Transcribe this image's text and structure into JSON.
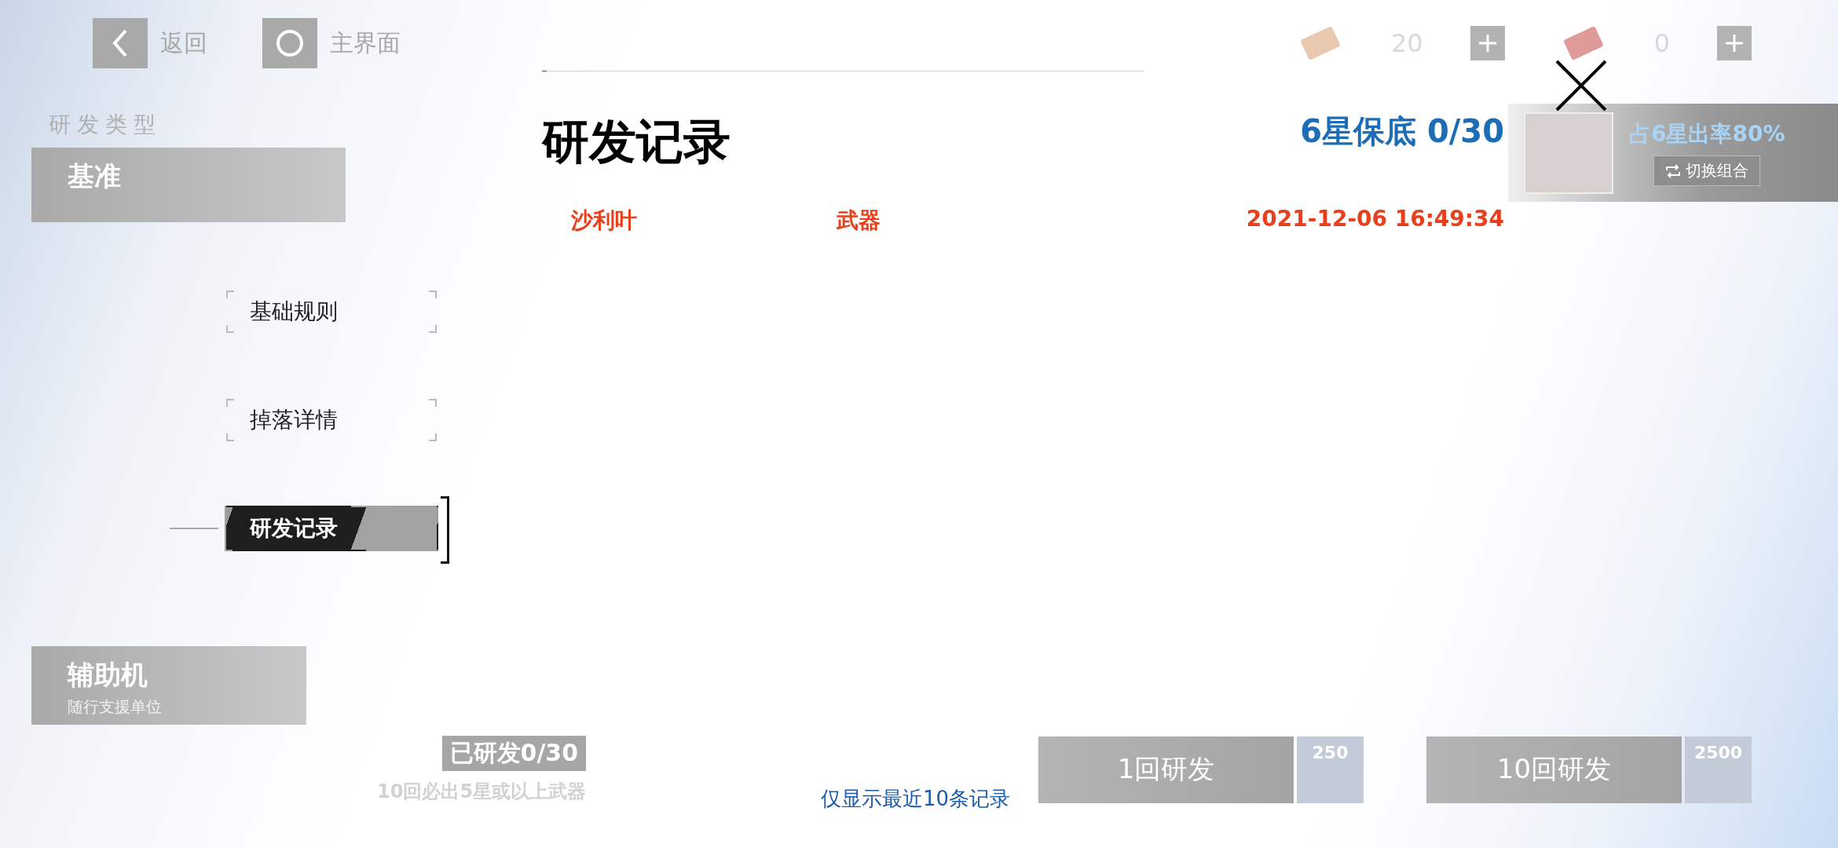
{
  "top_bar": {
    "back": "返回",
    "home": "主界面",
    "currencies": [
      {
        "amount": "20"
      },
      {
        "amount": "0"
      }
    ]
  },
  "left_panel": {
    "heading": "研发类型",
    "categories": [
      {
        "title": "基准"
      },
      {
        "title": "辅助机",
        "subtitle": "随行支援单位"
      }
    ]
  },
  "banner": {
    "rate": "占6星出率80%",
    "switch": "切换组合"
  },
  "bottom": {
    "progress": "已研发0/30",
    "guarantee": "10回必出**5星**或以上武器",
    "buttons": [
      {
        "label": "1回研发",
        "cost": "250"
      },
      {
        "label": "10回研发",
        "cost": "2500"
      }
    ]
  },
  "dialog": {
    "title": "研发记录",
    "pity": "6星保底 0/30",
    "tabs": [
      {
        "label": "基础规则",
        "selected": false
      },
      {
        "label": "掉落详情",
        "selected": false
      },
      {
        "label": "研发记录",
        "selected": true
      }
    ],
    "records": [
      {
        "name": "沙利叶",
        "type": "武器",
        "time": "2021-12-06 16:49:34"
      }
    ],
    "footnote": "仅显示最近10条记录"
  }
}
